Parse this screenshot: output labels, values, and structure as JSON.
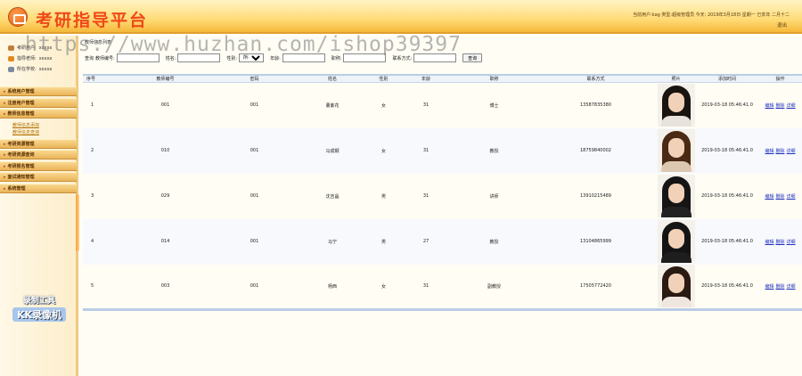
{
  "header": {
    "title": "考研指导平台",
    "user_info": "当前用户:kag 类型:超级管理员 今天: 2019年3月18日 星期一 已亥年 二月十二",
    "logout": "退出"
  },
  "watermark": "https://www.huzhan.com/ishop39397",
  "sidebar": {
    "info": [
      {
        "label": "考研用户: ",
        "value": "xxxxx",
        "color": "#c0803a"
      },
      {
        "label": "指导老师: ",
        "value": "xxxxx",
        "color": "#e08a20"
      },
      {
        "label": "所在学校: ",
        "value": "xxxxx",
        "color": "#7a8aa0"
      }
    ],
    "menu": [
      {
        "label": "系统用户管理"
      },
      {
        "label": "注册用户管理"
      },
      {
        "label": "教师信息管理",
        "subs": [
          "教师信息添加",
          "教师信息查询"
        ]
      },
      {
        "label": "考研资源管理"
      },
      {
        "label": "考研资源查询"
      },
      {
        "label": "考研报名管理"
      },
      {
        "label": "面试通知管理"
      },
      {
        "label": "系统管理"
      }
    ],
    "badge_line1": "录制工具",
    "badge_line2": "KK录像机"
  },
  "main": {
    "breadcrumb": "教师信息列表",
    "search": {
      "query_label": "查询",
      "teacher_no_label": "教师编号:",
      "name_label": "姓名:",
      "gender_label": "性别:",
      "gender_selected": "所有",
      "age_label": "年龄:",
      "title_label": "职称:",
      "contact_label": "联系方式:",
      "submit_label": "查询"
    },
    "columns": [
      "序号",
      "教师编号",
      "密码",
      "姓名",
      "性别",
      "年龄",
      "职称",
      "联系方式",
      "照片",
      "添加时间",
      "操作"
    ],
    "rows": [
      {
        "seq": "1",
        "no": "001",
        "pwd": "001",
        "name": "董紫花",
        "gender": "女",
        "age": "31",
        "title": "博士",
        "contact": "13587835380",
        "time": "2019-03-18 05:46:41.0",
        "photo": {
          "hair": "#1a1410",
          "body": "#e8e2dc"
        }
      },
      {
        "seq": "2",
        "no": "010",
        "pwd": "001",
        "name": "马成钢",
        "gender": "女",
        "age": "31",
        "title": "教授",
        "contact": "18759840002",
        "time": "2019-03-18 05:46:41.0",
        "photo": {
          "hair": "#4a2a14",
          "body": "#dcc8b0"
        }
      },
      {
        "seq": "3",
        "no": "029",
        "pwd": "001",
        "name": "沈吉晶",
        "gender": "男",
        "age": "31",
        "title": "讲师",
        "contact": "13910215489",
        "time": "2019-03-18 05:46:41.0",
        "photo": {
          "hair": "#151515",
          "body": "#222222"
        }
      },
      {
        "seq": "4",
        "no": "014",
        "pwd": "001",
        "name": "马宁",
        "gender": "男",
        "age": "27",
        "title": "教授",
        "contact": "13104865999",
        "time": "2019-03-18 05:46:41.0",
        "photo": {
          "hair": "#141414",
          "body": "#1e1e1e"
        }
      },
      {
        "seq": "5",
        "no": "003",
        "pwd": "001",
        "name": "杨西",
        "gender": "女",
        "age": "31",
        "title": "副教授",
        "contact": "17505772420",
        "time": "2019-03-18 05:46:41.0",
        "photo": {
          "hair": "#2a1a12",
          "body": "#f0e6e0"
        }
      }
    ],
    "actions": [
      "编辑",
      "删除",
      "详细"
    ]
  }
}
